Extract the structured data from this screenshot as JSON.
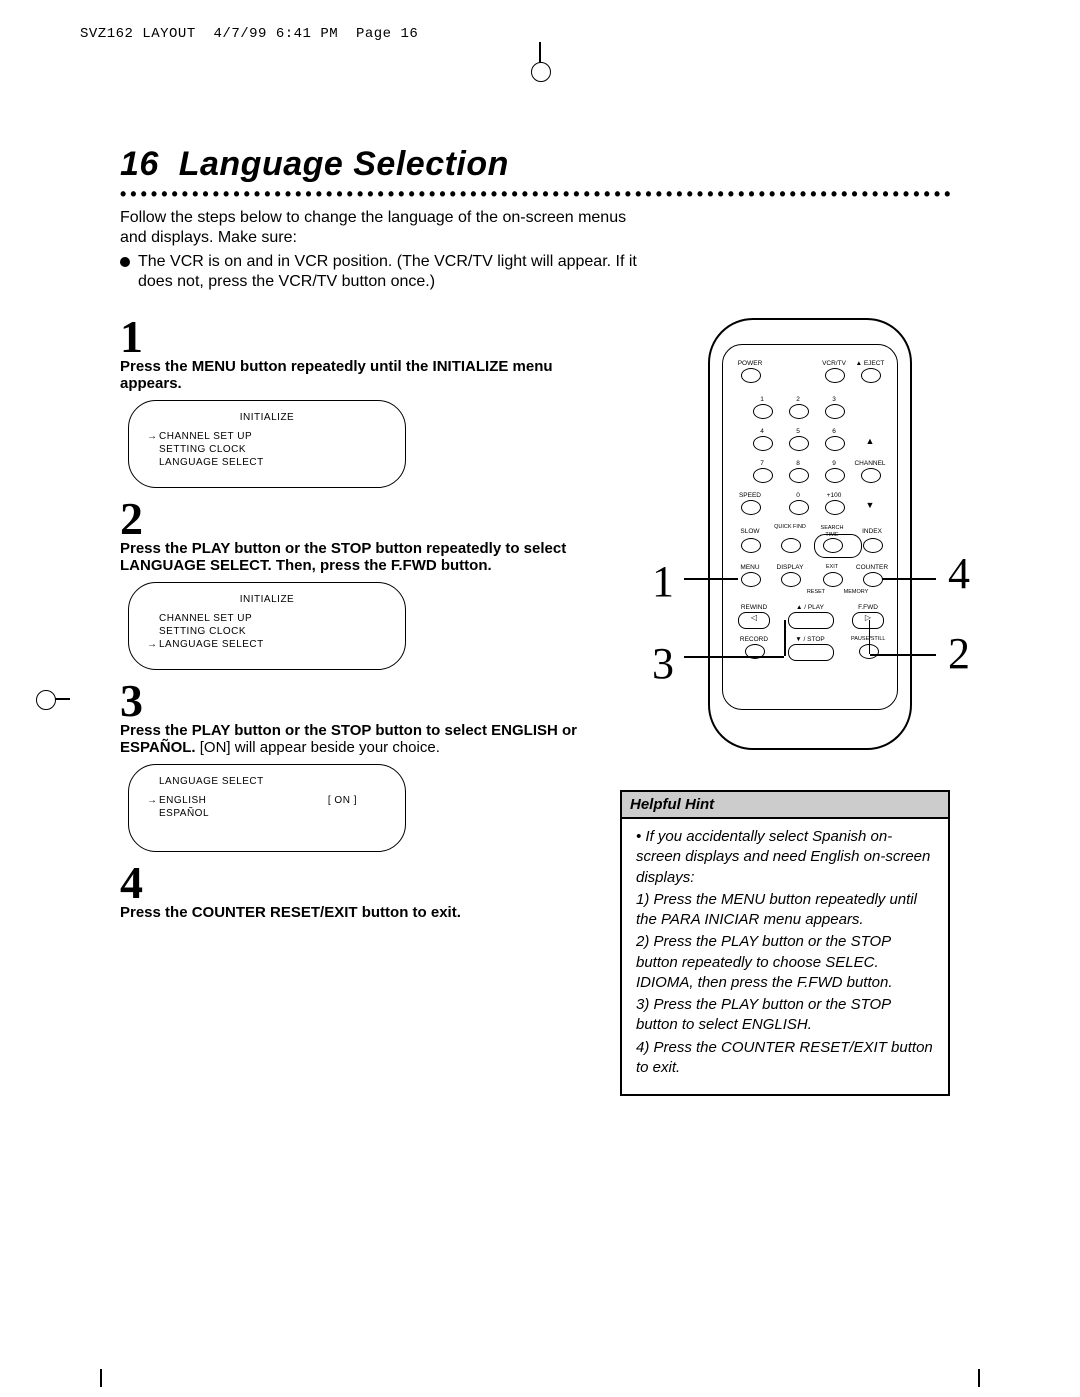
{
  "slug": {
    "file": "SVZ162 LAYOUT",
    "date": "4/7/99 6:41 PM",
    "page": "Page 16"
  },
  "title": {
    "number": "16",
    "text": "Language Selection"
  },
  "intro": {
    "lead": "Follow the steps below to change the language of the on-screen menus and displays. Make sure:",
    "bullet": "The VCR is on and in VCR position. (The VCR/TV light will appear. If it does not, press the VCR/TV button once.)"
  },
  "steps": [
    {
      "num": "1",
      "text": "Press the MENU button repeatedly until the INITIALIZE menu appears."
    },
    {
      "num": "2",
      "text": "Press the PLAY button or the STOP button repeatedly to select LANGUAGE SELECT. Then, press the F.FWD button."
    },
    {
      "num": "3",
      "bold": "Press the PLAY button or the STOP button to select ENGLISH or ESPAÑOL.",
      "plain": "[ON] will appear beside your choice."
    },
    {
      "num": "4",
      "text": "Press the COUNTER RESET/EXIT button to exit."
    }
  ],
  "osd1": {
    "title": "INITIALIZE",
    "arrow": "→",
    "l1": "CHANNEL SET UP",
    "l2": "SETTING CLOCK",
    "l3": "LANGUAGE SELECT"
  },
  "osd2": {
    "title": "INITIALIZE",
    "arrow": "→",
    "l1": "CHANNEL SET UP",
    "l2": "SETTING CLOCK",
    "l3": "LANGUAGE SELECT"
  },
  "osd3": {
    "title": "LANGUAGE SELECT",
    "arrow": "→",
    "l1": "ENGLISH",
    "l2": "ESPAÑOL",
    "state": "[ ON ]"
  },
  "remote": {
    "power": "POWER",
    "vcrtv": "VCR/TV",
    "eject": "▲ EJECT",
    "k1": "1",
    "k2": "2",
    "k3": "3",
    "k4": "4",
    "k5": "5",
    "k6": "6",
    "k7": "7",
    "k8": "8",
    "k9": "9",
    "k0": "0",
    "k100": "+100",
    "channel": "CHANNEL",
    "speed": "SPEED",
    "slow": "SLOW",
    "quick": "QUICK\nFIND",
    "search": "SEARCH",
    "time": "TIME",
    "index": "INDEX",
    "menu": "MENU",
    "display": "DISPLAY",
    "exit": "EXIT",
    "counter": "COUNTER",
    "reset": "RESET",
    "memory": "MEMORY",
    "rewind": "REWIND",
    "play": "▲ / PLAY",
    "ffwd": "F.FWD",
    "record": "RECORD",
    "stop": "▼ / STOP",
    "pause": "PAUSE/STILL"
  },
  "callouts": {
    "c1": "1",
    "c2": "2",
    "c3": "3",
    "c4": "4"
  },
  "hint": {
    "title": "Helpful Hint",
    "lead": "If you accidentally select Spanish on-screen displays and need English on-screen displays:",
    "s1": "1) Press the MENU button repeatedly until the PARA INICIAR menu appears.",
    "s2": "2) Press the PLAY button or the STOP button repeatedly to choose SELEC. IDIOMA, then press the F.FWD button.",
    "s3": "3) Press the PLAY button or the STOP button to select ENGLISH.",
    "s4": "4) Press the COUNTER RESET/EXIT button to exit."
  }
}
